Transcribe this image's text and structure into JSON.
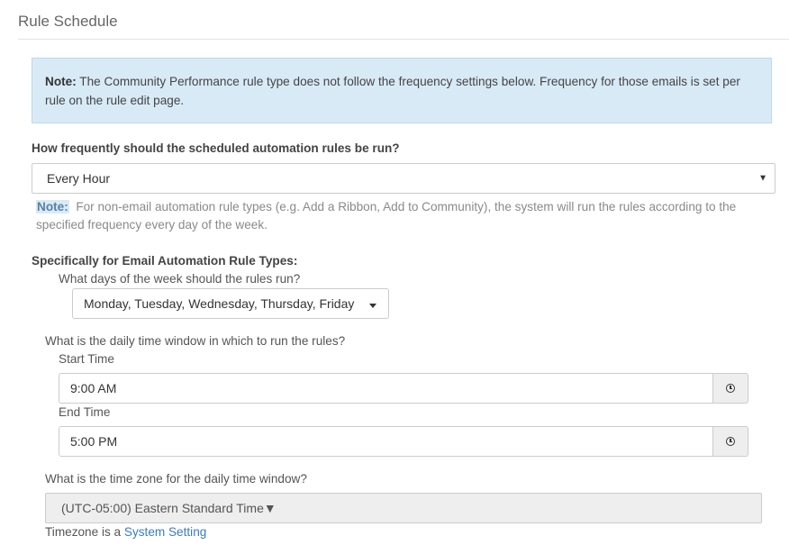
{
  "section": {
    "title": "Rule Schedule"
  },
  "note": {
    "label": "Note:",
    "text": " The Community Performance rule type does not follow the frequency settings below. Frequency for those emails is set per rule on the rule edit page."
  },
  "frequency": {
    "label": "How frequently should the scheduled automation rules be run?",
    "value": "Every Hour",
    "help_label": "Note:",
    "help_text": "For non-email automation rule types (e.g. Add a Ribbon, Add to Community), the system will run the rules according to the specified frequency every day of the week."
  },
  "email_rules": {
    "heading": "Specifically for Email Automation Rule Types:",
    "days_label": "What days of the week should the rules run?",
    "days_value": "Monday, Tuesday, Wednesday, Thursday, Friday",
    "window_label": "What is the daily time window in which to run the rules?",
    "start_label": "Start Time",
    "start_value": "9:00 AM",
    "end_label": "End Time",
    "end_value": "5:00 PM",
    "tz_label": "What is the time zone for the daily time window?",
    "tz_value": "(UTC-05:00) Eastern Standard Time",
    "tz_note_prefix": "Timezone is a ",
    "tz_note_link": "System Setting"
  },
  "icons": {
    "clock": "clock-icon",
    "caret": "caret-down-icon"
  },
  "colors": {
    "note_bg": "#d9eaf7",
    "link": "#3a7cc4"
  }
}
